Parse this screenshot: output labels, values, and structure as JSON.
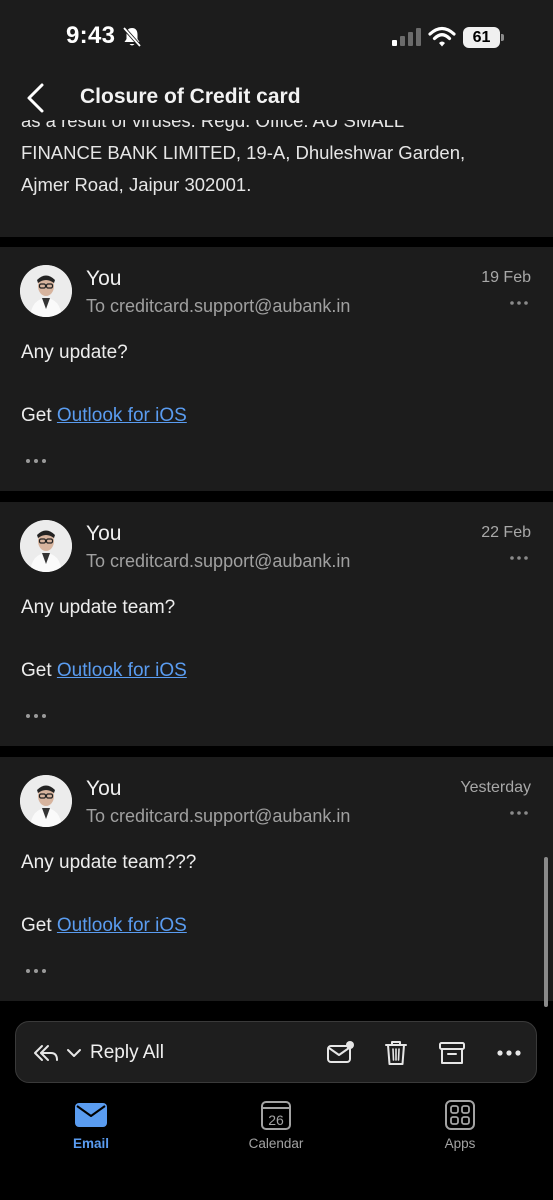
{
  "status_bar": {
    "time": "9:43",
    "battery": "61"
  },
  "header": {
    "title": "Closure of Credit card"
  },
  "previous_message_footer": {
    "lines": [
      "as a result of viruses.  Regd. Office: AU SMALL",
      "FINANCE BANK LIMITED, 19-A, Dhuleshwar Garden,",
      "Ajmer Road, Jaipur 302001."
    ]
  },
  "messages": [
    {
      "sender": "You",
      "to": "To creditcard.support@aubank.in",
      "date": "19 Feb",
      "body": "Any update?",
      "signature_prefix": "Get ",
      "signature_link": "Outlook for iOS"
    },
    {
      "sender": "You",
      "to": "To creditcard.support@aubank.in",
      "date": "22 Feb",
      "body": "Any update team?",
      "signature_prefix": "Get ",
      "signature_link": "Outlook for iOS"
    },
    {
      "sender": "You",
      "to": "To creditcard.support@aubank.in",
      "date": "Yesterday",
      "body": "Any update team???",
      "signature_prefix": "Get ",
      "signature_link": "Outlook for iOS"
    }
  ],
  "action_bar": {
    "reply_label": "Reply All",
    "icons": [
      "reply-all-icon",
      "chevron-down-icon",
      "mark-unread-icon",
      "trash-icon",
      "archive-icon",
      "more-icon"
    ]
  },
  "tab_bar": {
    "tabs": [
      {
        "label": "Email",
        "icon": "email-icon",
        "active": true
      },
      {
        "label": "Calendar",
        "icon": "calendar-icon",
        "calendar_day": "26",
        "active": false
      },
      {
        "label": "Apps",
        "icon": "apps-icon",
        "active": false
      }
    ]
  },
  "colors": {
    "accent": "#5a9cf0",
    "background": "#000000",
    "card": "#1c1c1c"
  }
}
